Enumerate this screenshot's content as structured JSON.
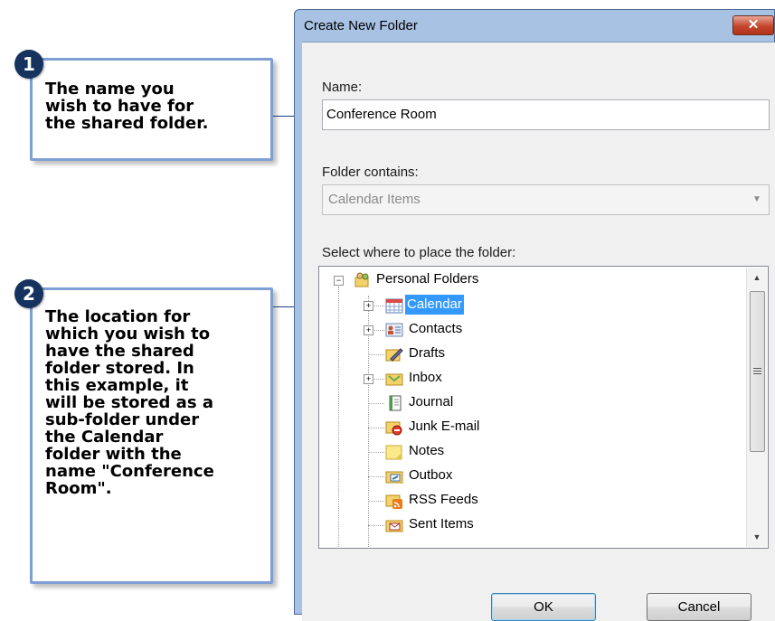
{
  "callouts": [
    {
      "number": "1",
      "lines": [
        "The name you",
        "wish to have for",
        "the shared folder."
      ]
    },
    {
      "number": "2",
      "lines": [
        "The location for",
        "which you wish to",
        "have the shared",
        "folder stored. In",
        "this example, it",
        "will be stored as a",
        "sub-folder under",
        "the Calendar",
        "folder with the",
        "name \"Conference",
        "Room\"."
      ]
    }
  ],
  "dialog": {
    "title": "Create New Folder",
    "close_label": "✕",
    "name_label": "Name:",
    "name_value": "Conference Room",
    "contains_label": "Folder contains:",
    "contains_value": "Calendar Items",
    "place_label": "Select where to place the folder:",
    "ok_label": "OK",
    "cancel_label": "Cancel"
  },
  "tree": {
    "root": {
      "label": "Personal Folders",
      "icon": "personal-folders-icon"
    },
    "items": [
      {
        "label": "Calendar",
        "icon": "calendar-icon",
        "expandable": true,
        "selected": true
      },
      {
        "label": "Contacts",
        "icon": "contacts-icon",
        "expandable": true
      },
      {
        "label": "Drafts",
        "icon": "drafts-icon"
      },
      {
        "label": "Inbox",
        "icon": "inbox-icon",
        "expandable": true
      },
      {
        "label": "Journal",
        "icon": "journal-icon"
      },
      {
        "label": "Junk E-mail",
        "icon": "junk-email-icon"
      },
      {
        "label": "Notes",
        "icon": "notes-icon"
      },
      {
        "label": "Outbox",
        "icon": "outbox-icon"
      },
      {
        "label": "RSS Feeds",
        "icon": "rss-feeds-icon"
      },
      {
        "label": "Sent Items",
        "icon": "sent-items-icon"
      }
    ]
  },
  "colors": {
    "selection": "#3399ff",
    "callout_border": "#7f9fd4",
    "badge": "#16325e",
    "dialog_frame": "#a8c2e3"
  }
}
